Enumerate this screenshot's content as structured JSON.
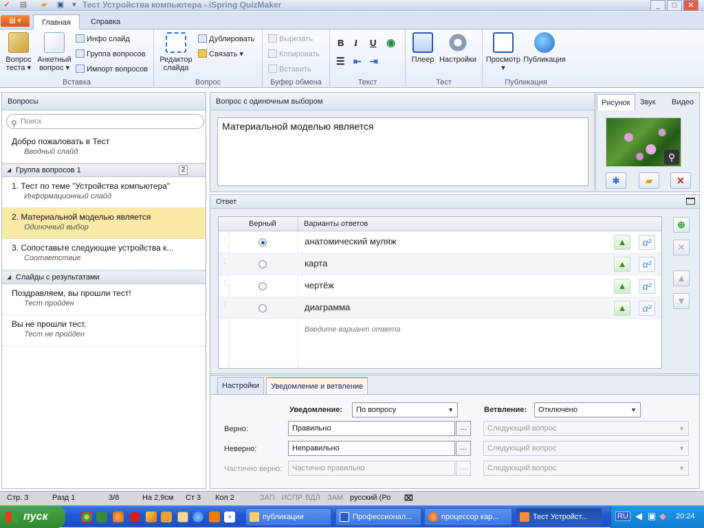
{
  "window": {
    "title": "Тест Устройства компьютера - iSpring QuizMaker"
  },
  "ribbon_tabs": [
    "Главная",
    "Справка"
  ],
  "ribbon": {
    "insert": {
      "label": "Вставка",
      "quiz_q": "Вопрос теста",
      "survey_q": "Анкетный вопрос",
      "info_slide": "Инфо слайд",
      "q_group": "Группа вопросов",
      "q_import": "Импорт вопросов"
    },
    "question": {
      "label": "Вопрос",
      "slide_editor": "Редактор слайда",
      "duplicate": "Дублировать",
      "link": "Связать"
    },
    "clipboard": {
      "label": "Буфер обмена",
      "cut": "Вырезать",
      "copy": "Копировать",
      "paste": "Вставить"
    },
    "text": {
      "label": "Текст",
      "bold": "B",
      "italic": "I",
      "underline": "U"
    },
    "test": {
      "label": "Тест",
      "player": "Плеер",
      "settings": "Настройки"
    },
    "publish": {
      "label": "Публикация",
      "preview": "Просмотр",
      "publish": "Публикация"
    }
  },
  "left_panel": {
    "header": "Вопросы",
    "search_placeholder": "Поиск",
    "intro": {
      "title": "Добро пожаловать в Тест",
      "sub": "Вводный слайд"
    },
    "group1": {
      "title": "Группа вопросов 1",
      "count": "2"
    },
    "items": [
      {
        "title": "1. Тест по теме  \"Устройства компьютера\"",
        "sub": "Информационный слайд"
      },
      {
        "title": "2. Материальной моделью является",
        "sub": "Одиночный выбор"
      },
      {
        "title": "3. Сопоставьте следующие устройства  к...",
        "sub": "Соответствие"
      }
    ],
    "group2": {
      "title": "Слайды с результатами"
    },
    "results": [
      {
        "title": "Поздравляем, вы прошли тест!",
        "sub": "Тест пройден"
      },
      {
        "title": "Вы не прошли тест.",
        "sub": "Тест не пройден"
      }
    ]
  },
  "question": {
    "header": "Вопрос с одиночным выбором",
    "text": "Материальной моделью является"
  },
  "media": {
    "tabs": [
      "Рисунок",
      "Звук",
      "Видео"
    ]
  },
  "answers": {
    "header": "Ответ",
    "col_correct": "Верный",
    "col_options": "Варианты ответов",
    "rows": [
      "анатомический муляж",
      "карта",
      "чертёж",
      "диаграмма"
    ],
    "placeholder": "Введите вариант ответа"
  },
  "bottom": {
    "tabs": [
      "Настройки",
      "Уведомление и ветвление"
    ],
    "notify_label": "Уведомление:",
    "notify_value": "По вопросу",
    "branch_label": "Ветвление:",
    "branch_value": "Отключено",
    "correct_label": "Верно:",
    "correct_value": "Правильно",
    "incorrect_label": "Неверно:",
    "incorrect_value": "Неправильно",
    "partial_label": "Частично верно:",
    "partial_value": "Частично правильно",
    "next_q": "Следующий вопрос"
  },
  "statusbar": {
    "page": "Стр. 3",
    "section": "Разд 1",
    "pages": "3/8",
    "at": "На 2,9см",
    "line": "Ст 3",
    "col": "Кол 2",
    "rec": "ЗАП",
    "trk": "ИСПР",
    "ext": "ВДЛ",
    "ovr": "ЗАМ",
    "lang": "русский (Ро"
  },
  "taskbar": {
    "start": "пуск",
    "tasks": [
      "публикации",
      "Профессионал...",
      "процессор кар...",
      "Тест Устройст..."
    ],
    "lang": "RU",
    "time": "20:24"
  }
}
